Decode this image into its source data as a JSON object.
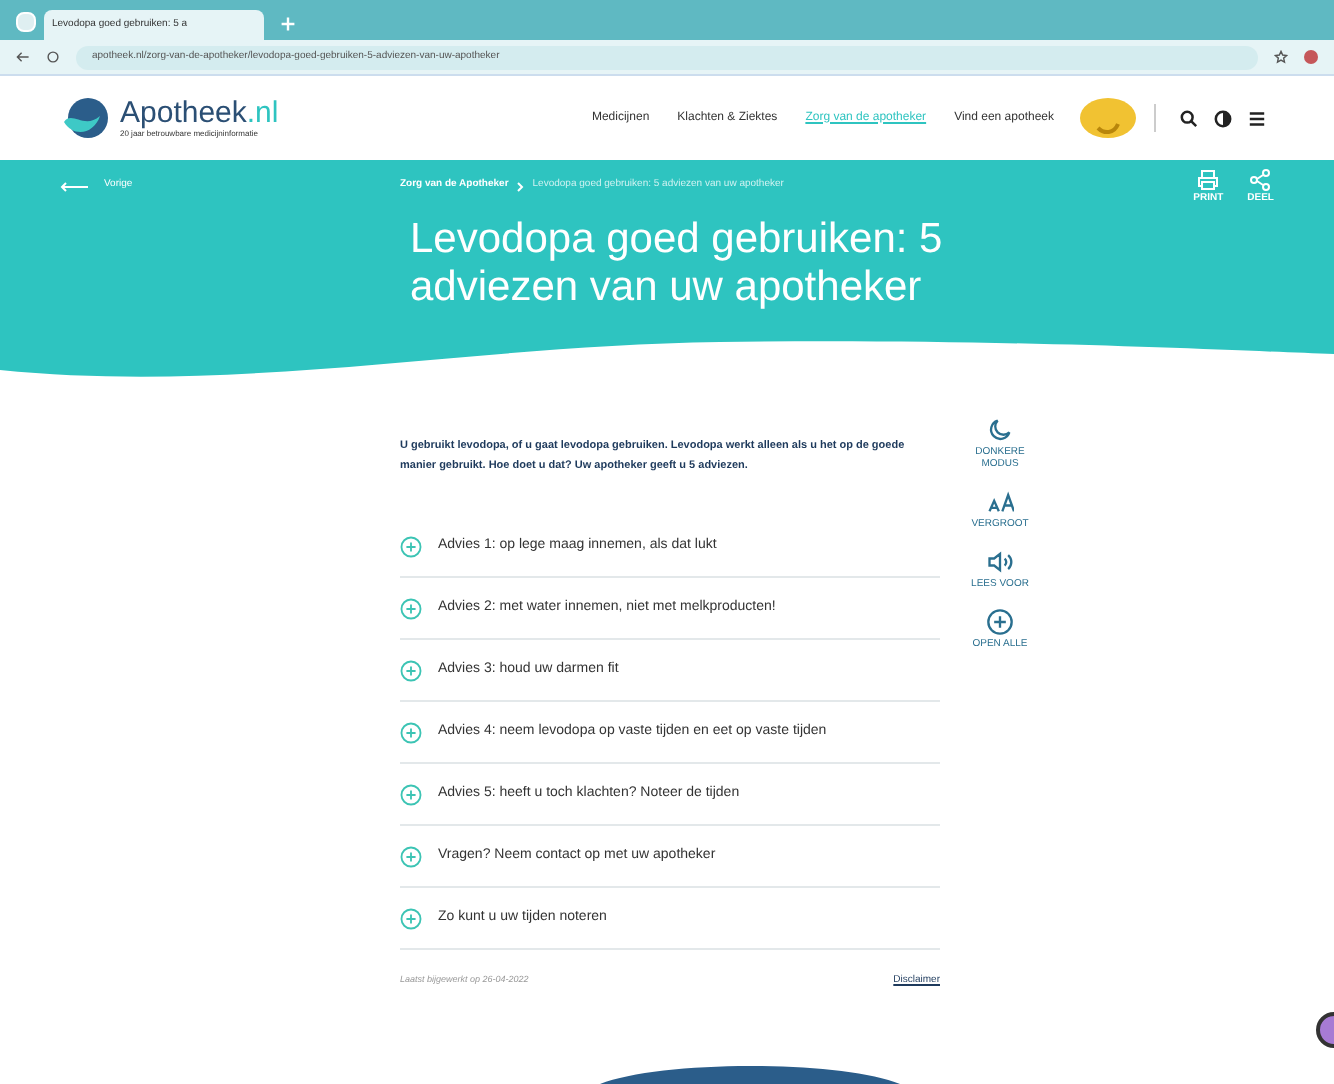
{
  "browser": {
    "tabs": [
      {
        "label": "Levodopa goed gebruiken: 5 a",
        "selected": true
      }
    ],
    "url": "apotheek.nl/zorg-van-de-apotheker/levodopa-goed-gebruiken-5-adviezen-van-uw-apotheker"
  },
  "header": {
    "logo": "Apotheek",
    "logo_suffix": ".nl",
    "tagline": "20 jaar betrouwbare medicijninformatie",
    "nav": [
      {
        "label": "Medicijnen",
        "selected": false
      },
      {
        "label": "Klachten & Ziektes",
        "selected": false
      },
      {
        "label": "Zorg van de apotheker",
        "selected": true
      },
      {
        "label": "Vind een apotheek",
        "selected": false
      }
    ]
  },
  "banner": {
    "back": "Vorige",
    "breadcrumb": [
      {
        "label": "Zorg van de Apotheker",
        "kind": "link"
      },
      {
        "label": "Levodopa goed gebruiken: 5 adviezen van uw apotheker",
        "kind": "current"
      }
    ],
    "title": "Levodopa goed gebruiken: 5 adviezen van uw apotheker",
    "actions": [
      {
        "label": "PRINT",
        "kind": "print"
      },
      {
        "label": "DEEL",
        "kind": "share"
      }
    ]
  },
  "intro": "U gebruikt levodopa, of u gaat levodopa gebruiken. Levodopa werkt alleen als u het op de goede manier gebruikt. Hoe doet u dat? Uw apotheker geeft u 5 adviezen.",
  "tools": [
    {
      "label": "DONKERE MODUS",
      "kind": "dark"
    },
    {
      "label": "VERGROOT",
      "kind": "zoom"
    },
    {
      "label": "LEES VOOR",
      "kind": "read"
    },
    {
      "label": "OPEN ALLE",
      "kind": "open"
    }
  ],
  "sections": [
    {
      "title": "Advies 1: op lege maag innemen, als dat lukt",
      "expanded": false
    },
    {
      "title": "Advies 2: met water innemen, niet met melkproducten!",
      "expanded": false
    },
    {
      "title": "Advies 3: houd uw darmen fit",
      "expanded": false
    },
    {
      "title": "Advies 4: neem levodopa op vaste tijden en eet op vaste tijden",
      "expanded": false
    },
    {
      "title": "Advies 5: heeft u toch klachten? Noteer de tijden",
      "expanded": false
    },
    {
      "title": "Vragen? Neem contact op met uw apotheker",
      "expanded": false
    },
    {
      "title": "Zo kunt u uw tijden noteren",
      "expanded": false
    }
  ],
  "footer": {
    "updated": "Laatst bijgewerkt op 26-04-2022",
    "disclaimer": "Disclaimer"
  }
}
